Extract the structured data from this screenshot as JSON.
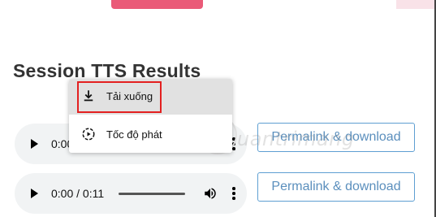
{
  "page": {
    "title": "Session TTS Results"
  },
  "players": [
    {
      "time": "0:00",
      "permalink_label": "Permalink & download"
    },
    {
      "time": "0:00 / 0:11",
      "permalink_label": "Permalink & download"
    }
  ],
  "context_menu": {
    "items": [
      {
        "label": "Tải xuống",
        "icon": "download-icon",
        "highlighted": true
      },
      {
        "label": "Tốc độ phát",
        "icon": "playback-speed-icon"
      }
    ]
  },
  "watermark": {
    "text": "uantrimang",
    "icon": "lightbulb-icon"
  },
  "colors": {
    "accent_top": "#ea5a78",
    "button_border": "#5e9fd2",
    "button_text": "#5b8fbd",
    "highlight": "#e32020",
    "player_bg": "#f1f3f4"
  }
}
